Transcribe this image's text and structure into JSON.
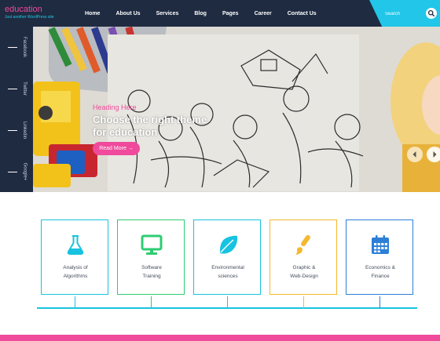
{
  "site": {
    "title": "education",
    "tagline": "Just another WordPress site"
  },
  "nav": {
    "items": [
      "Home",
      "About Us",
      "Services",
      "Blog",
      "Pages",
      "Career",
      "Contact Us"
    ]
  },
  "search": {
    "placeholder": "Search"
  },
  "social": {
    "items": [
      "Facebook",
      "Twitter",
      "Linkedin",
      "Google+"
    ]
  },
  "hero": {
    "heading": "Heading Here",
    "title": "Choose the right theme for education",
    "button": "Read More →"
  },
  "cards": [
    {
      "icon": "flask-icon",
      "label_line1": "Analysis of",
      "label_line2": "Algorithms",
      "color": "#17c3e0"
    },
    {
      "icon": "monitor-icon",
      "label_line1": "Software",
      "label_line2": "Training",
      "color": "#2ecc71"
    },
    {
      "icon": "leaf-icon",
      "label_line1": "Environmental",
      "label_line2": "sciences",
      "color": "#17c3e0"
    },
    {
      "icon": "paintbrush-icon",
      "label_line1": "Graphic &",
      "label_line2": "Web-Design",
      "color": "#f5b82e"
    },
    {
      "icon": "calendar-icon",
      "label_line1": "Economics &",
      "label_line2": "Finance",
      "color": "#2d7fd6"
    }
  ],
  "colors": {
    "header_bg": "#1f2b41",
    "accent_pink": "#ef4a9c",
    "accent_cyan": "#21c6e8"
  }
}
